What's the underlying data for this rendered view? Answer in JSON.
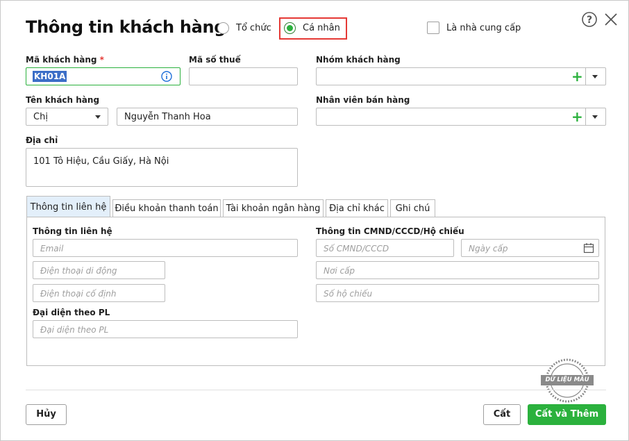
{
  "dialog": {
    "title": "Thông tin khách hàng",
    "type_options": [
      {
        "label": "Tổ chức",
        "selected": false
      },
      {
        "label": "Cá nhân",
        "selected": true
      }
    ],
    "supplier_checkbox": {
      "label": "Là nhà cung cấp",
      "checked": false
    },
    "help_icon": "question-circle-icon",
    "close_icon": "close-icon"
  },
  "form": {
    "customer_code": {
      "label": "Mã khách hàng",
      "required_mark": "*",
      "value": "KH01A"
    },
    "tax_code": {
      "label": "Mã số thuế",
      "value": ""
    },
    "customer_group": {
      "label": "Nhóm khách hàng",
      "value": ""
    },
    "customer_name": {
      "label": "Tên khách hàng",
      "salutation": "Chị",
      "value": "Nguyễn Thanh Hoa"
    },
    "sales_staff": {
      "label": "Nhân viên bán hàng",
      "value": ""
    },
    "address": {
      "label": "Địa chỉ",
      "value": "101 Tô Hiệu, Cầu Giấy, Hà Nội"
    }
  },
  "tabs": [
    {
      "label": "Thông tin liên hệ",
      "active": true
    },
    {
      "label": "Điều khoản thanh toán",
      "active": false
    },
    {
      "label": "Tài khoản ngân hàng",
      "active": false
    },
    {
      "label": "Địa chỉ khác",
      "active": false
    },
    {
      "label": "Ghi chú",
      "active": false
    }
  ],
  "contact": {
    "section_title": "Thông tin liên hệ",
    "email_placeholder": "Email",
    "mobile_placeholder": "Điện thoại di động",
    "landline_placeholder": "Điện thoại cố định",
    "rep_title": "Đại diện theo PL",
    "rep_placeholder": "Đại diện theo PL"
  },
  "identity": {
    "section_title": "Thông tin CMND/CCCD/Hộ chiếu",
    "id_placeholder": "Số CMND/CCCD",
    "issue_date_placeholder": "Ngày cấp",
    "issue_place_placeholder": "Nơi cấp",
    "passport_placeholder": "Số hộ chiếu"
  },
  "stamp_text": "DỮ LIỆU MẪU",
  "footer": {
    "cancel_label": "Hủy",
    "save_label": "Cất",
    "save_add_label": "Cất và Thêm"
  },
  "colors": {
    "accent": "#2bb13d",
    "highlight": "#e53935",
    "tab_active_bg": "#e3effa",
    "selection": "#3b6ec7"
  }
}
